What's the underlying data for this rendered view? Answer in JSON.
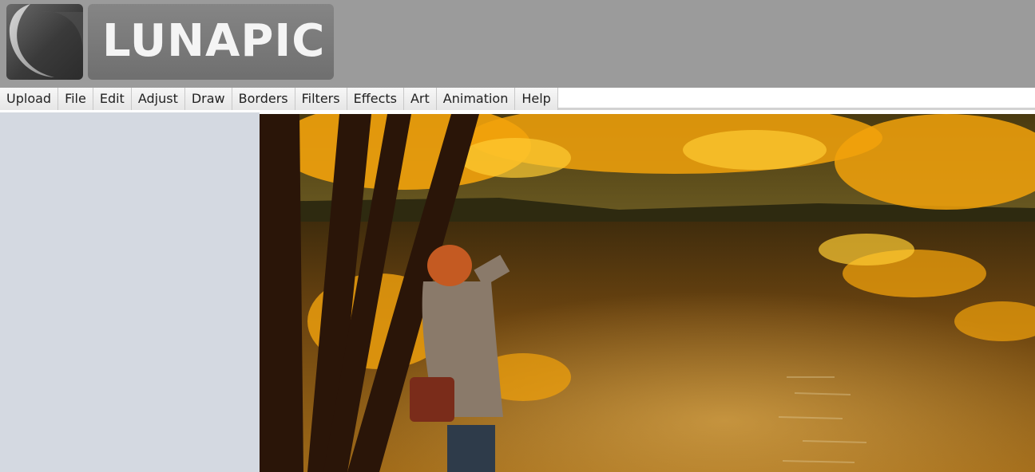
{
  "app": {
    "logo_text": "LUNAPIC",
    "logo_icon": "lunapic-moon-icon"
  },
  "menu": {
    "items": [
      {
        "label": "Upload"
      },
      {
        "label": "File"
      },
      {
        "label": "Edit"
      },
      {
        "label": "Adjust"
      },
      {
        "label": "Draw"
      },
      {
        "label": "Borders"
      },
      {
        "label": "Filters"
      },
      {
        "label": "Effects"
      },
      {
        "label": "Art"
      },
      {
        "label": "Animation"
      },
      {
        "label": "Help"
      }
    ]
  },
  "canvas": {
    "image_subject": "autumn lake with photographer"
  },
  "colors": {
    "header_bg": "#9b9b9b",
    "sidebar_bg": "#d4d9e1",
    "leaf_orange": "#f2a20c",
    "water": "#6b4410"
  }
}
